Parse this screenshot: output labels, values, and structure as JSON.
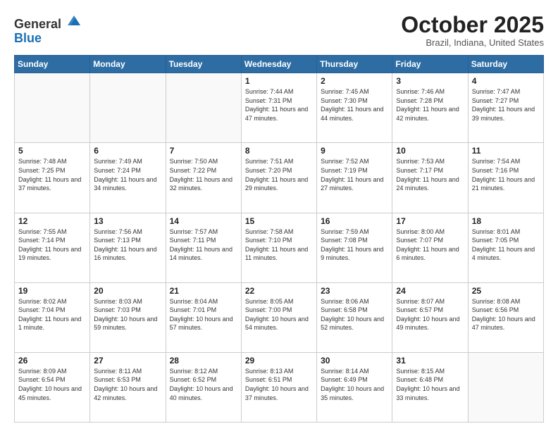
{
  "header": {
    "logo_general": "General",
    "logo_blue": "Blue",
    "month": "October 2025",
    "location": "Brazil, Indiana, United States"
  },
  "weekdays": [
    "Sunday",
    "Monday",
    "Tuesday",
    "Wednesday",
    "Thursday",
    "Friday",
    "Saturday"
  ],
  "weeks": [
    [
      {
        "day": "",
        "info": ""
      },
      {
        "day": "",
        "info": ""
      },
      {
        "day": "",
        "info": ""
      },
      {
        "day": "1",
        "info": "Sunrise: 7:44 AM\nSunset: 7:31 PM\nDaylight: 11 hours\nand 47 minutes."
      },
      {
        "day": "2",
        "info": "Sunrise: 7:45 AM\nSunset: 7:30 PM\nDaylight: 11 hours\nand 44 minutes."
      },
      {
        "day": "3",
        "info": "Sunrise: 7:46 AM\nSunset: 7:28 PM\nDaylight: 11 hours\nand 42 minutes."
      },
      {
        "day": "4",
        "info": "Sunrise: 7:47 AM\nSunset: 7:27 PM\nDaylight: 11 hours\nand 39 minutes."
      }
    ],
    [
      {
        "day": "5",
        "info": "Sunrise: 7:48 AM\nSunset: 7:25 PM\nDaylight: 11 hours\nand 37 minutes."
      },
      {
        "day": "6",
        "info": "Sunrise: 7:49 AM\nSunset: 7:24 PM\nDaylight: 11 hours\nand 34 minutes."
      },
      {
        "day": "7",
        "info": "Sunrise: 7:50 AM\nSunset: 7:22 PM\nDaylight: 11 hours\nand 32 minutes."
      },
      {
        "day": "8",
        "info": "Sunrise: 7:51 AM\nSunset: 7:20 PM\nDaylight: 11 hours\nand 29 minutes."
      },
      {
        "day": "9",
        "info": "Sunrise: 7:52 AM\nSunset: 7:19 PM\nDaylight: 11 hours\nand 27 minutes."
      },
      {
        "day": "10",
        "info": "Sunrise: 7:53 AM\nSunset: 7:17 PM\nDaylight: 11 hours\nand 24 minutes."
      },
      {
        "day": "11",
        "info": "Sunrise: 7:54 AM\nSunset: 7:16 PM\nDaylight: 11 hours\nand 21 minutes."
      }
    ],
    [
      {
        "day": "12",
        "info": "Sunrise: 7:55 AM\nSunset: 7:14 PM\nDaylight: 11 hours\nand 19 minutes."
      },
      {
        "day": "13",
        "info": "Sunrise: 7:56 AM\nSunset: 7:13 PM\nDaylight: 11 hours\nand 16 minutes."
      },
      {
        "day": "14",
        "info": "Sunrise: 7:57 AM\nSunset: 7:11 PM\nDaylight: 11 hours\nand 14 minutes."
      },
      {
        "day": "15",
        "info": "Sunrise: 7:58 AM\nSunset: 7:10 PM\nDaylight: 11 hours\nand 11 minutes."
      },
      {
        "day": "16",
        "info": "Sunrise: 7:59 AM\nSunset: 7:08 PM\nDaylight: 11 hours\nand 9 minutes."
      },
      {
        "day": "17",
        "info": "Sunrise: 8:00 AM\nSunset: 7:07 PM\nDaylight: 11 hours\nand 6 minutes."
      },
      {
        "day": "18",
        "info": "Sunrise: 8:01 AM\nSunset: 7:05 PM\nDaylight: 11 hours\nand 4 minutes."
      }
    ],
    [
      {
        "day": "19",
        "info": "Sunrise: 8:02 AM\nSunset: 7:04 PM\nDaylight: 11 hours\nand 1 minute."
      },
      {
        "day": "20",
        "info": "Sunrise: 8:03 AM\nSunset: 7:03 PM\nDaylight: 10 hours\nand 59 minutes."
      },
      {
        "day": "21",
        "info": "Sunrise: 8:04 AM\nSunset: 7:01 PM\nDaylight: 10 hours\nand 57 minutes."
      },
      {
        "day": "22",
        "info": "Sunrise: 8:05 AM\nSunset: 7:00 PM\nDaylight: 10 hours\nand 54 minutes."
      },
      {
        "day": "23",
        "info": "Sunrise: 8:06 AM\nSunset: 6:58 PM\nDaylight: 10 hours\nand 52 minutes."
      },
      {
        "day": "24",
        "info": "Sunrise: 8:07 AM\nSunset: 6:57 PM\nDaylight: 10 hours\nand 49 minutes."
      },
      {
        "day": "25",
        "info": "Sunrise: 8:08 AM\nSunset: 6:56 PM\nDaylight: 10 hours\nand 47 minutes."
      }
    ],
    [
      {
        "day": "26",
        "info": "Sunrise: 8:09 AM\nSunset: 6:54 PM\nDaylight: 10 hours\nand 45 minutes."
      },
      {
        "day": "27",
        "info": "Sunrise: 8:11 AM\nSunset: 6:53 PM\nDaylight: 10 hours\nand 42 minutes."
      },
      {
        "day": "28",
        "info": "Sunrise: 8:12 AM\nSunset: 6:52 PM\nDaylight: 10 hours\nand 40 minutes."
      },
      {
        "day": "29",
        "info": "Sunrise: 8:13 AM\nSunset: 6:51 PM\nDaylight: 10 hours\nand 37 minutes."
      },
      {
        "day": "30",
        "info": "Sunrise: 8:14 AM\nSunset: 6:49 PM\nDaylight: 10 hours\nand 35 minutes."
      },
      {
        "day": "31",
        "info": "Sunrise: 8:15 AM\nSunset: 6:48 PM\nDaylight: 10 hours\nand 33 minutes."
      },
      {
        "day": "",
        "info": ""
      }
    ]
  ]
}
